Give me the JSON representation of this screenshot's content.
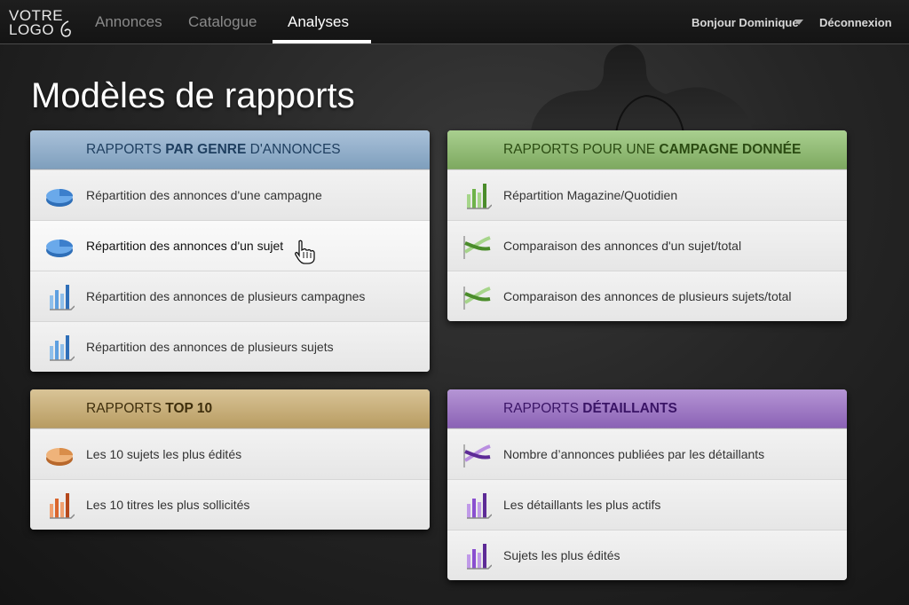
{
  "logo": {
    "line1": "VOTRE",
    "line2": "LOGO"
  },
  "nav": {
    "items": [
      "Annonces",
      "Catalogue",
      "Analyses"
    ],
    "active": "Analyses"
  },
  "user": {
    "greeting": "Bonjour Dominique",
    "logout": "Déconnexion"
  },
  "page_title": "Modèles de rapports",
  "colors": {
    "blue": "#8eaac6",
    "green": "#8cbb6e",
    "gold": "#c6ac74",
    "purple": "#9b74c4"
  },
  "panels": {
    "genre": {
      "title_pre": "RAPPORTS ",
      "title_bold": "PAR GENRE",
      "title_post": " D'ANNONCES",
      "items": [
        {
          "label": "Répartition des annonces d'une campagne",
          "icon": "pie-chart-icon"
        },
        {
          "label": "Répartition des annonces d'un sujet",
          "icon": "pie-chart-icon"
        },
        {
          "label": "Répartition des annonces de plusieurs campagnes",
          "icon": "bar-chart-icon"
        },
        {
          "label": "Répartition des annonces de plusieurs sujets",
          "icon": "bar-chart-icon"
        }
      ]
    },
    "campagne": {
      "title_pre": "RAPPORTS POUR UNE ",
      "title_bold": "CAMPAGNE DONNÉE",
      "title_post": "",
      "items": [
        {
          "label": "Répartition Magazine/Quotidien",
          "icon": "bar-chart-icon"
        },
        {
          "label": "Comparaison des annonces d'un sujet/total",
          "icon": "line-chart-icon"
        },
        {
          "label": "Comparaison des annonces de plusieurs sujets/total",
          "icon": "line-chart-icon"
        }
      ]
    },
    "top10": {
      "title_pre": "RAPPORTS ",
      "title_bold": "TOP 10",
      "title_post": "",
      "items": [
        {
          "label": "Les 10 sujets les plus édités",
          "icon": "pie-chart-icon"
        },
        {
          "label": "Les 10 titres les plus sollicités",
          "icon": "bar-chart-icon"
        }
      ]
    },
    "detaillants": {
      "title_pre": "RAPPORTS ",
      "title_bold": "DÉTAILLANTS",
      "title_post": "",
      "items": [
        {
          "label": "Nombre d’annonces publiées par les détaillants",
          "icon": "line-chart-icon"
        },
        {
          "label": "Les détaillants les plus actifs",
          "icon": "bar-chart-icon"
        },
        {
          "label": "Sujets les plus édités",
          "icon": "bar-chart-icon"
        }
      ]
    }
  }
}
